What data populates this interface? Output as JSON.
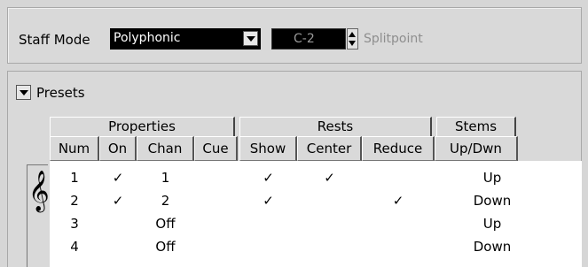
{
  "staff_mode": {
    "label": "Staff Mode",
    "selected": "Polyphonic",
    "splitpoint_value": "C-2",
    "splitpoint_label": "Splitpoint"
  },
  "presets": {
    "label": "Presets"
  },
  "groups": [
    "Properties",
    "Rests",
    "Stems"
  ],
  "columns": [
    "Num",
    "On",
    "Chan",
    "Cue",
    "Show",
    "Center",
    "Reduce",
    "Up/Dwn"
  ],
  "rows": [
    {
      "num": "1",
      "on": "✓",
      "chan": "1",
      "cue": "",
      "show": "✓",
      "center": "✓",
      "reduce": "",
      "updwn": "Up"
    },
    {
      "num": "2",
      "on": "✓",
      "chan": "2",
      "cue": "",
      "show": "✓",
      "center": "",
      "reduce": "✓",
      "updwn": "Down"
    },
    {
      "num": "3",
      "on": "",
      "chan": "Off",
      "cue": "",
      "show": "",
      "center": "",
      "reduce": "",
      "updwn": "Up"
    },
    {
      "num": "4",
      "on": "",
      "chan": "Off",
      "cue": "",
      "show": "",
      "center": "",
      "reduce": "",
      "updwn": "Down"
    }
  ],
  "icons": {
    "clef": "treble-clef-icon"
  }
}
